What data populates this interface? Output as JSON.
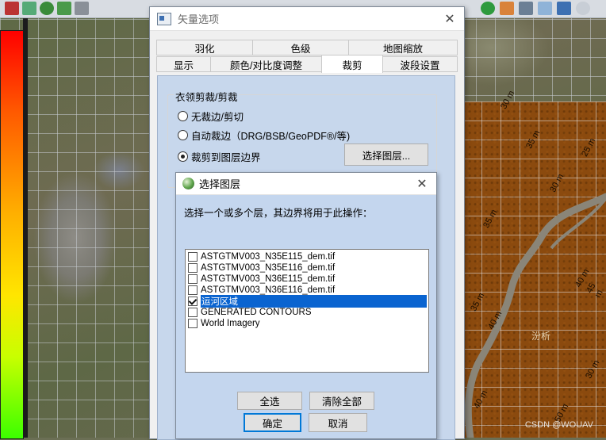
{
  "background": {
    "watermark": "CSDN @WOUAV",
    "contour_labels": [
      "30 m",
      "35 m",
      "25 m",
      "30 m",
      "35 m",
      "40 m",
      "45 m",
      "35 m",
      "40 m",
      "30 m",
      "50 m",
      "40 m"
    ],
    "place_label": "汾析",
    "colors": {
      "dem": "#8b4a0e",
      "river": "#8a8578"
    }
  },
  "main_dialog": {
    "title": "矢量选项",
    "tabs_row1": [
      "羽化",
      "色级",
      "地图缩放"
    ],
    "tabs_row2": [
      "显示",
      "颜色/对比度调整",
      "裁剪",
      "波段设置"
    ],
    "active_tab": "裁剪",
    "group_label": "衣领剪裁/剪裁",
    "options": [
      {
        "label": "无裁边/剪切",
        "checked": false
      },
      {
        "label": "自动裁边（DRG/BSB/GeoPDF®/等)",
        "checked": false
      },
      {
        "label": "裁剪到图层边界",
        "checked": true
      }
    ],
    "select_layer_button": "选择图层..."
  },
  "sub_dialog": {
    "title": "选择图层",
    "prompt": "选择一个或多个层，其边界将用于此操作：",
    "layers": [
      {
        "label": "ASTGTMV003_N35E115_dem.tif",
        "checked": false,
        "selected": false
      },
      {
        "label": "ASTGTMV003_N35E116_dem.tif",
        "checked": false,
        "selected": false
      },
      {
        "label": "ASTGTMV003_N36E115_dem.tif",
        "checked": false,
        "selected": false
      },
      {
        "label": "ASTGTMV003_N36E116_dem.tif",
        "checked": false,
        "selected": false
      },
      {
        "label": "运河区域",
        "checked": true,
        "selected": true
      },
      {
        "label": "GENERATED CONTOURS",
        "checked": false,
        "selected": false
      },
      {
        "label": "World Imagery",
        "checked": false,
        "selected": false
      }
    ],
    "select_all": "全选",
    "clear_all": "清除全部",
    "ok": "确定",
    "cancel": "取消"
  }
}
